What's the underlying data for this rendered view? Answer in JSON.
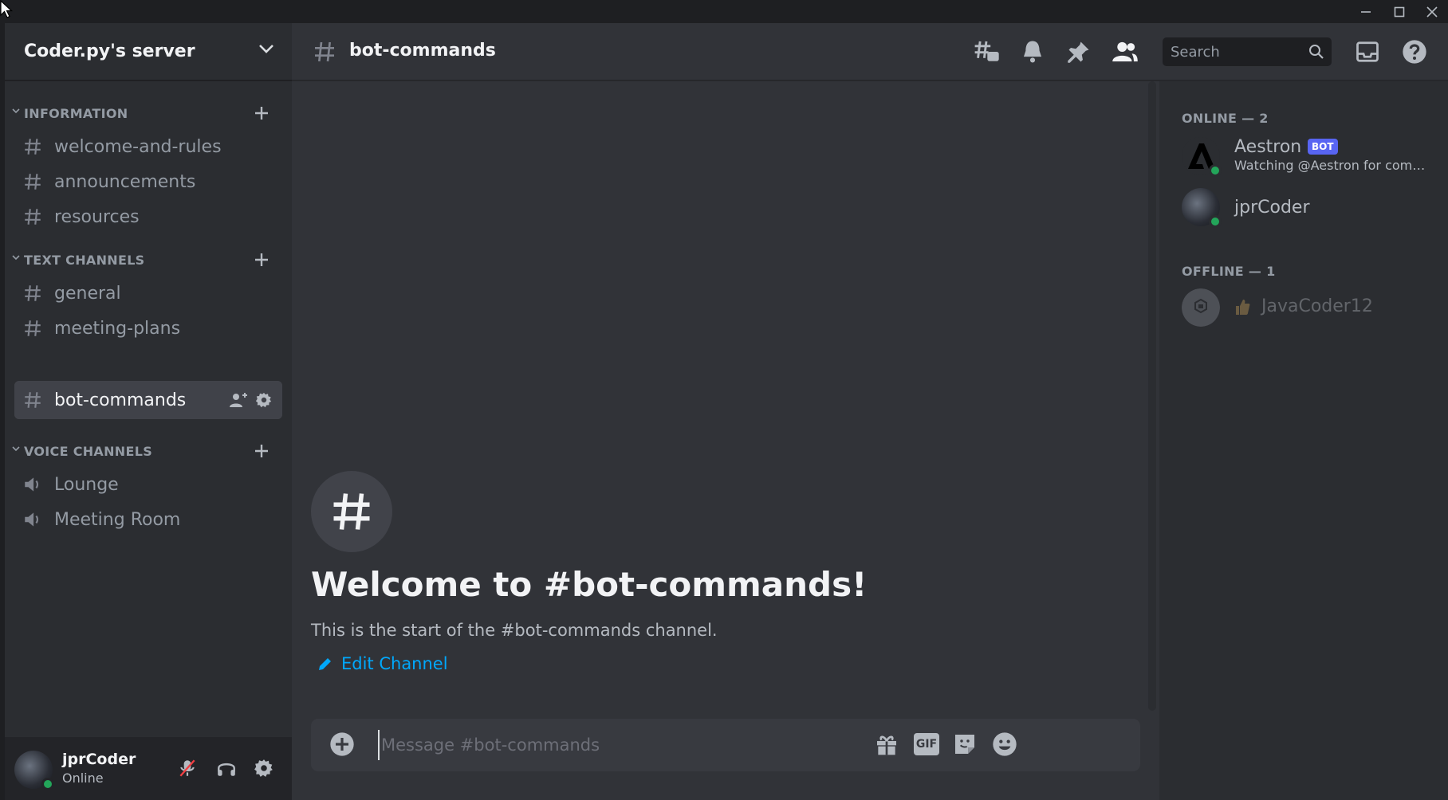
{
  "window": {
    "controls": [
      "minimize-icon",
      "maximize-icon",
      "close-icon"
    ]
  },
  "server": {
    "name": "Coder.py's server"
  },
  "sidebar": {
    "categories": [
      {
        "label": "INFORMATION",
        "channels": [
          {
            "label": "welcome-and-rules",
            "icon": "hash-icon"
          },
          {
            "label": "announcements",
            "icon": "hash-icon"
          },
          {
            "label": "resources",
            "icon": "hash-icon"
          }
        ]
      },
      {
        "label": "TEXT CHANNELS",
        "channels": [
          {
            "label": "general",
            "icon": "hash-icon"
          },
          {
            "label": "meeting-plans",
            "icon": "hash-icon"
          },
          {
            "label": "bot-commands",
            "icon": "hash-icon",
            "active": true
          }
        ]
      },
      {
        "label": "VOICE CHANNELS",
        "channels": [
          {
            "label": "Lounge",
            "icon": "speaker-icon"
          },
          {
            "label": "Meeting Room",
            "icon": "speaker-icon"
          }
        ]
      }
    ]
  },
  "user_panel": {
    "username": "jprCoder",
    "status": "Online"
  },
  "header": {
    "channel": "bot-commands",
    "search_placeholder": "Search"
  },
  "chat": {
    "welcome_title": "Welcome to #bot-commands!",
    "welcome_subtitle": "This is the start of the #bot-commands channel.",
    "edit_channel": "Edit Channel",
    "composer_placeholder": "Message #bot-commands",
    "gif_label": "GIF"
  },
  "members": {
    "online_label": "ONLINE — 2",
    "offline_label": "OFFLINE — 1",
    "online": [
      {
        "name": "Aestron",
        "badge": "BOT",
        "activity": "Watching @Aestron for commands"
      },
      {
        "name": "jprCoder"
      }
    ],
    "offline": [
      {
        "name": "JavaCoder12"
      }
    ]
  },
  "colors": {
    "background": "#313338",
    "sidebar": "#2b2d31",
    "active_channel": "#404249",
    "link": "#00a8fc",
    "online": "#23a55a",
    "bot_badge": "#5865f2"
  }
}
